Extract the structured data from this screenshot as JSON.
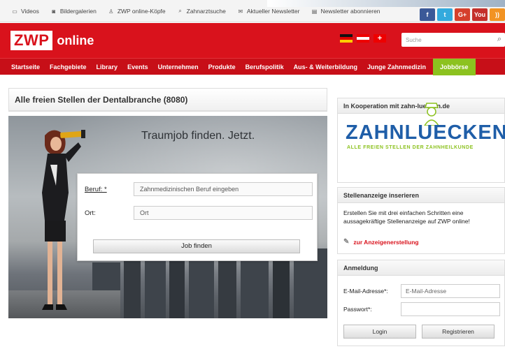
{
  "toplinks": [
    {
      "icon": "video-icon",
      "label": "Videos"
    },
    {
      "icon": "camera-icon",
      "label": "Bildergalerien"
    },
    {
      "icon": "person-icon",
      "label": "ZWP online-Köpfe"
    },
    {
      "icon": "search-icon",
      "label": "Zahnarztsuche"
    },
    {
      "icon": "mail-icon",
      "label": "Aktueller Newsletter"
    },
    {
      "icon": "newsletter-icon",
      "label": "Newsletter abonnieren"
    }
  ],
  "social": [
    {
      "icon": "facebook-icon",
      "label": "f",
      "color": "#3b5998"
    },
    {
      "icon": "twitter-icon",
      "label": "t",
      "color": "#33aadd"
    },
    {
      "icon": "googleplus-icon",
      "label": "G+",
      "color": "#d5402c"
    },
    {
      "icon": "youtube-icon",
      "label": "You",
      "color": "#c4302b"
    },
    {
      "icon": "rss-icon",
      "label": "))",
      "color": "#f29323"
    }
  ],
  "logo": {
    "mark": "ZWP",
    "word": "online"
  },
  "search": {
    "placeholder": "Suche"
  },
  "nav": [
    "Startseite",
    "Fachgebiete",
    "Library",
    "Events",
    "Unternehmen",
    "Produkte",
    "Berufspolitik",
    "Aus- & Weiterbildung",
    "Junge Zahnmedizin",
    "Jobbörse"
  ],
  "main": {
    "title": "Alle freien Stellen der Dentalbranche (8080)",
    "slogan": "Traumjob finden. Jetzt.",
    "form": {
      "beruf_label": "Beruf: *",
      "beruf_placeholder": "Zahnmedizinischen Beruf eingeben",
      "ort_label": "Ort:",
      "ort_placeholder": "Ort",
      "submit": "Job finden"
    }
  },
  "sidebar": {
    "koop_title": "In Kooperation mit zahn-luecken.de",
    "zl_logo_text": "ZAHNLUECKEN",
    "zl_tagline": "ALLE FREIEN STELLEN DER ZAHNHEILKUNDE",
    "stellen_title": "Stellenanzeige inserieren",
    "stellen_text": "Erstellen Sie mit drei einfachen Schritten eine aussagekräftige Stellenanzeige auf ZWP online!",
    "stellen_link": "zur Anzeigenerstellung",
    "login_title": "Anmeldung",
    "email_label": "E-Mail-Adresse*:",
    "email_placeholder": "E-Mail-Adresse",
    "password_label": "Passwort*:",
    "login_button": "Login",
    "register_button": "Registrieren"
  },
  "colors": {
    "brand_red": "#d9121c",
    "nav_active": "#8cc21f",
    "zl_blue": "#1f5ea8"
  }
}
